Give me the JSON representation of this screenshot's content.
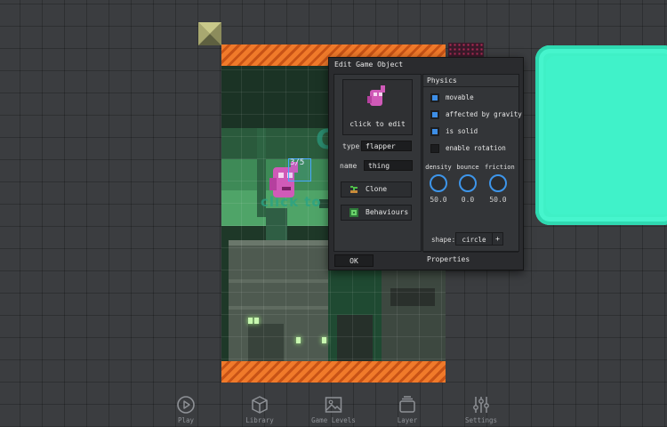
{
  "dialog": {
    "title": "Edit Game Object",
    "preview_label": "click to edit",
    "type_label": "type",
    "type_value": "flapper",
    "name_label": "name",
    "name_value": "thing",
    "clone_label": "Clone",
    "behaviors_label": "Behaviours",
    "ok_label": "OK"
  },
  "physics": {
    "title": "Physics",
    "checkboxes": [
      {
        "label": "movable",
        "checked": true
      },
      {
        "label": "affected by gravity",
        "checked": true
      },
      {
        "label": "is solid",
        "checked": true
      },
      {
        "label": "enable rotation",
        "checked": false
      }
    ],
    "knobs": [
      {
        "label": "density",
        "value": "50.0"
      },
      {
        "label": "bounce",
        "value": "0.0"
      },
      {
        "label": "friction",
        "value": "50.0"
      }
    ],
    "shape_label": "shape:",
    "shape_value": "circle",
    "shape_add": "+",
    "properties_title": "Properties"
  },
  "scene": {
    "selection_label": "3/5",
    "ghost_text": "click to",
    "ghost_letter": "C"
  },
  "toolbar": [
    {
      "label": "Play",
      "icon": "play-icon"
    },
    {
      "label": "Library",
      "icon": "cube-icon"
    },
    {
      "label": "Game Levels",
      "icon": "image-icon"
    },
    {
      "label": "Layer",
      "icon": "layers-icon"
    },
    {
      "label": "Settings",
      "icon": "sliders-icon"
    }
  ],
  "colors": {
    "accent": "#3d8ee6",
    "platform": "#3ff0c6",
    "stripe": "#f07a2a",
    "background": "#3b3d40"
  }
}
